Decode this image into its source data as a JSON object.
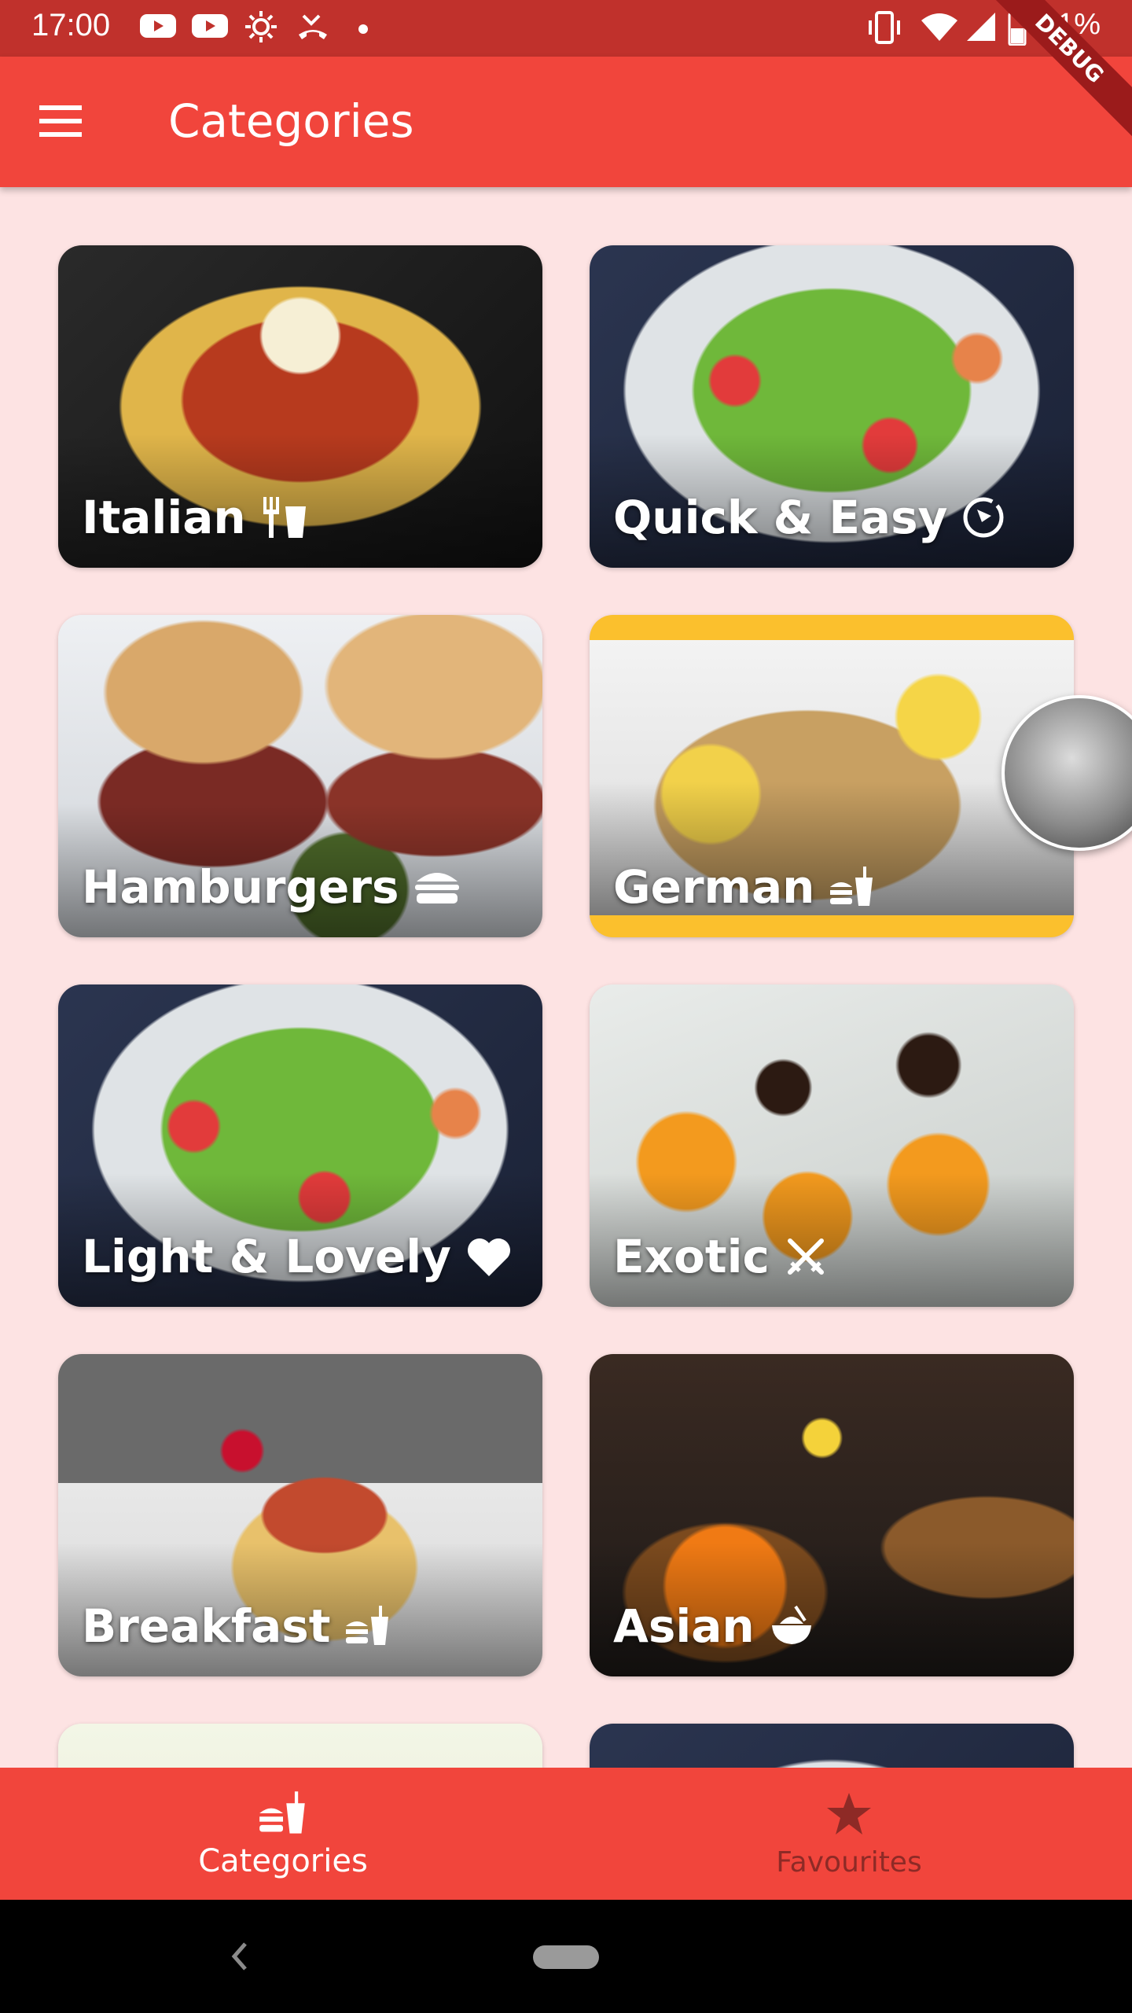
{
  "status": {
    "time": "17:00",
    "battery": "51%",
    "icons": [
      "youtube-icon",
      "youtube-icon",
      "brightness-icon",
      "missed-call-icon",
      "dot-icon",
      "vibrate-icon",
      "wifi-icon",
      "signal-icon",
      "battery-icon"
    ]
  },
  "app_bar": {
    "title": "Categories",
    "menu_icon": "hamburger-menu-icon"
  },
  "debug_banner": "DEBUG",
  "colors": {
    "primary": "#f1453c",
    "status_bar": "#c0312c",
    "background": "#fde3e3",
    "accent_yellow": "#fbc02d",
    "nav_inactive": "#8e2a26"
  },
  "categories": [
    {
      "label": "Italian",
      "icon": "fork-cup-icon"
    },
    {
      "label": "Quick & Easy",
      "icon": "timer-icon"
    },
    {
      "label": "Hamburgers",
      "icon": "burger-icon"
    },
    {
      "label": "German",
      "icon": "fastfood-icon"
    },
    {
      "label": "Light & Lovely",
      "icon": "heart-icon"
    },
    {
      "label": "Exotic",
      "icon": "crossed-swords-icon"
    },
    {
      "label": "Breakfast",
      "icon": "fastfood-icon"
    },
    {
      "label": "Asian",
      "icon": "rice-bowl-icon"
    }
  ],
  "bottom_nav": {
    "items": [
      {
        "label": "Categories",
        "icon": "fastfood-icon",
        "active": true
      },
      {
        "label": "Favourites",
        "icon": "star-icon",
        "active": false
      }
    ]
  }
}
